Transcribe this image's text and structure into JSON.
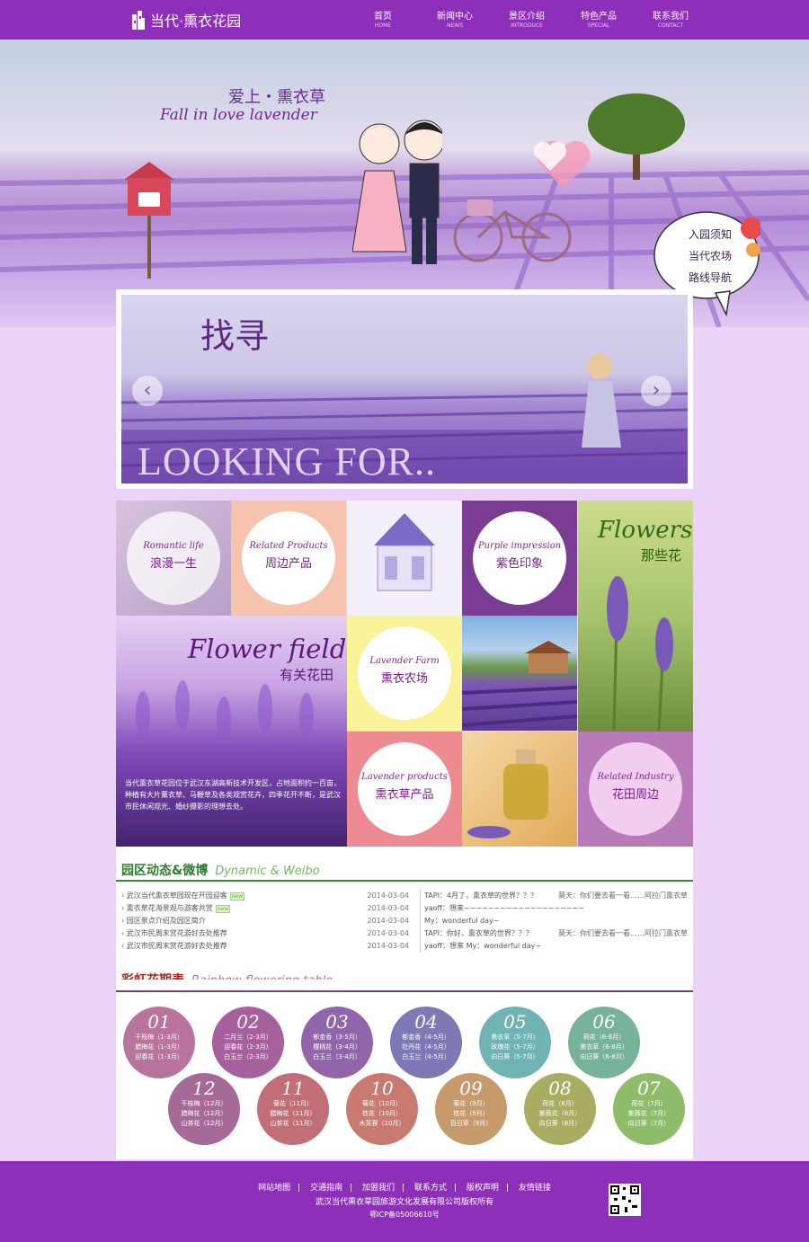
{
  "header": {
    "logo_text": "当代·熏衣花园",
    "nav": [
      {
        "cn": "首页",
        "en": "HOME"
      },
      {
        "cn": "新闻中心",
        "en": "NEWS"
      },
      {
        "cn": "景区介绍",
        "en": "INTRODUCE"
      },
      {
        "cn": "特色产品",
        "en": "SPECIAL"
      },
      {
        "cn": "联系我们",
        "en": "CONTACT"
      }
    ]
  },
  "hero": {
    "tagline_cn": "爱上・熏衣草",
    "tagline_en": "Fall in love lavender",
    "quick_links": [
      "入园须知",
      "当代农场",
      "路线导航"
    ]
  },
  "slider": {
    "title_cn": "找寻",
    "title_en": "LOOKING FOR..",
    "prev": "‹",
    "next": "›"
  },
  "tiles": {
    "romantic": {
      "en": "Romantic life",
      "cn": "浪漫一生"
    },
    "products": {
      "en": "Related Products",
      "cn": "周边产品"
    },
    "purple": {
      "en": "Purple impression",
      "cn": "紫色印象"
    },
    "flowers": {
      "en": "Flowers",
      "cn": "那些花"
    },
    "field": {
      "en": "Flower field",
      "cn": "有关花田",
      "desc": "当代熏衣草花园位于武汉东湖高新技术开发区，占地面积约一百亩，种植有大片薰衣草、马鞭草及各类观赏花卉，四季花开不断，是武汉市民休闲观光、婚纱摄影的理想去处。"
    },
    "farm": {
      "en": "Lavender Farm",
      "cn": "熏衣农场"
    },
    "lproducts": {
      "en": "Lavender products",
      "cn": "熏衣草产品"
    },
    "industry": {
      "en": "Related Industry",
      "cn": "花田周边"
    }
  },
  "news": {
    "title_cn": "园区动态&微博",
    "title_en": "Dynamic & Weibo",
    "new_badge": "new",
    "items": [
      {
        "title": "武汉当代熏衣草园现在开园迎客",
        "date": "2014-03-04",
        "new": true
      },
      {
        "title": "熏衣草花海景观与游客共赏",
        "date": "2014-03-04",
        "new": true
      },
      {
        "title": "园区景点介绍及园区简介",
        "date": "2014-03-04",
        "new": false
      },
      {
        "title": "武汉市民周末赏花游好去处推荐",
        "date": "2014-03-04",
        "new": false
      },
      {
        "title": "武汉市民周末赏花游好去处推荐",
        "date": "2014-03-04",
        "new": false
      }
    ],
    "weibo": [
      {
        "l": "TAPI：4月了，熏衣草的世界？？？",
        "r": "莫天：你们要去看一看……阿拉门熏衣草"
      },
      {
        "l": "yaoff：想来~~~~~~~~~~~~~~~~~~~~",
        "r": ""
      },
      {
        "l": "My：wonderful day~",
        "r": ""
      },
      {
        "l": "TAPI：你好，熏衣草的世界？？？",
        "r": "莫天：你们要去看一看……阿拉门熏衣草"
      },
      {
        "l": "yaoff：想来 My：wonderful day~",
        "r": ""
      }
    ]
  },
  "rainbow": {
    "title_cn": "彩虹花期表",
    "title_en": "Rainbow flowering table",
    "months": [
      {
        "num": "01",
        "lines": [
          "干枝梅（1-3月）",
          "腊梅花（1-3月）",
          "迎春花（1-3月）"
        ],
        "color": "#b8749c"
      },
      {
        "num": "02",
        "lines": [
          "二月兰（2-3月）",
          "迎春花（2-3月）",
          "白玉兰（2-3月）"
        ],
        "color": "#a6609d"
      },
      {
        "num": "03",
        "lines": [
          "郁金香（3-5月）",
          "樱桃花（3-4月）",
          "白玉兰（3-4月）"
        ],
        "color": "#9165a9"
      },
      {
        "num": "04",
        "lines": [
          "郁金香（4-5月）",
          "牡丹花（4-5月）",
          "白玉兰（4-5月）"
        ],
        "color": "#7d79b7"
      },
      {
        "num": "05",
        "lines": [
          "熏衣草（5-7月）",
          "玫瑰花（5-7月）",
          "向日葵（5-7月）"
        ],
        "color": "#6fb3b5"
      },
      {
        "num": "06",
        "lines": [
          "荷花（6-8月）",
          "熏衣草（6-8月）",
          "向日葵（6-8月）"
        ],
        "color": "#77b398"
      },
      {
        "num": "12",
        "lines": [
          "干枝梅（12月）",
          "腊梅花（12月）",
          "山茶花（12月）"
        ],
        "color": "#a66a98"
      },
      {
        "num": "11",
        "lines": [
          "菊花（11月）",
          "腊梅花（11月）",
          "山茶花（11月）"
        ],
        "color": "#c16e76"
      },
      {
        "num": "10",
        "lines": [
          "菊花（10月）",
          "桂花（10月）",
          "木芙蓉（10月）"
        ],
        "color": "#c87a71"
      },
      {
        "num": "09",
        "lines": [
          "菊花（9月）",
          "桂花（9月）",
          "百日草（9月）"
        ],
        "color": "#c79a6c"
      },
      {
        "num": "08",
        "lines": [
          "荷花（8月）",
          "紫薇花（8月）",
          "向日葵（8月）"
        ],
        "color": "#a8ad61"
      },
      {
        "num": "07",
        "lines": [
          "荷花（7月）",
          "紫薇花（7月）",
          "向日葵（7月）"
        ],
        "color": "#8fbc6b"
      }
    ]
  },
  "footer": {
    "links": [
      "网站地图",
      "交通指南",
      "加盟我们",
      "联系方式",
      "版权声明",
      "友情链接"
    ],
    "copyright": "武汉当代熏衣草园旅游文化发展有限公司版权所有",
    "icp": "鄂ICP备05006610号"
  }
}
